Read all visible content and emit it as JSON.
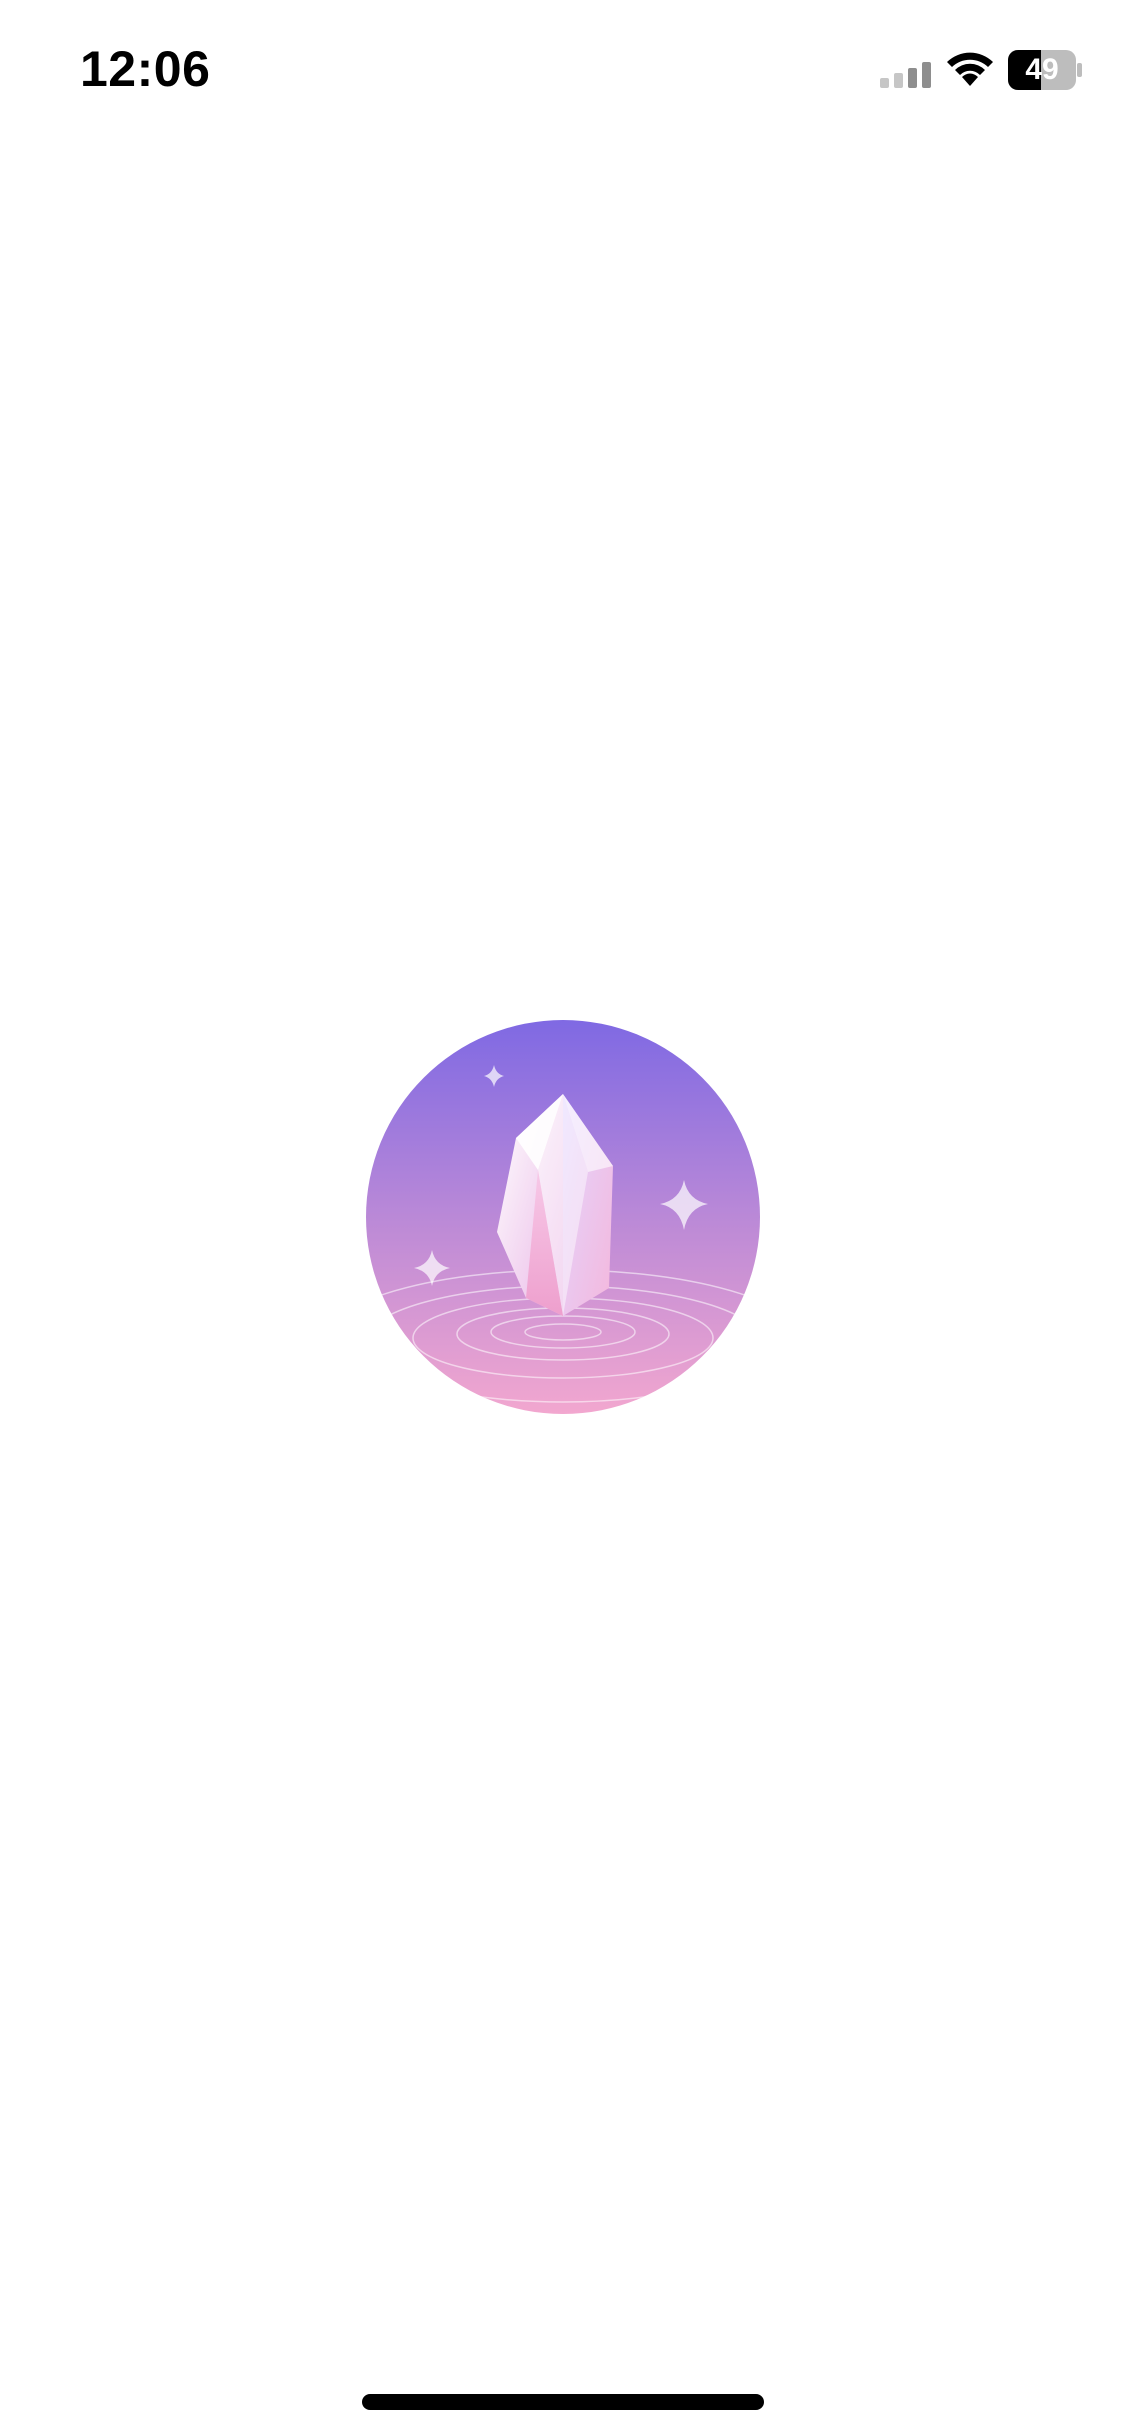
{
  "status_bar": {
    "time": "12:06",
    "signal_icon": "cellular-signal-icon",
    "signal_bars_active": 2,
    "signal_bars_total": 4,
    "wifi_icon": "wifi-icon",
    "battery_icon": "battery-icon",
    "battery_level": "49",
    "battery_fraction": 0.49
  },
  "splash": {
    "logo_icon": "crystal-logo-icon",
    "gradient_top": "#7f69e3",
    "gradient_bottom": "#f0a6d1"
  },
  "home_indicator": {
    "icon": "home-indicator"
  }
}
